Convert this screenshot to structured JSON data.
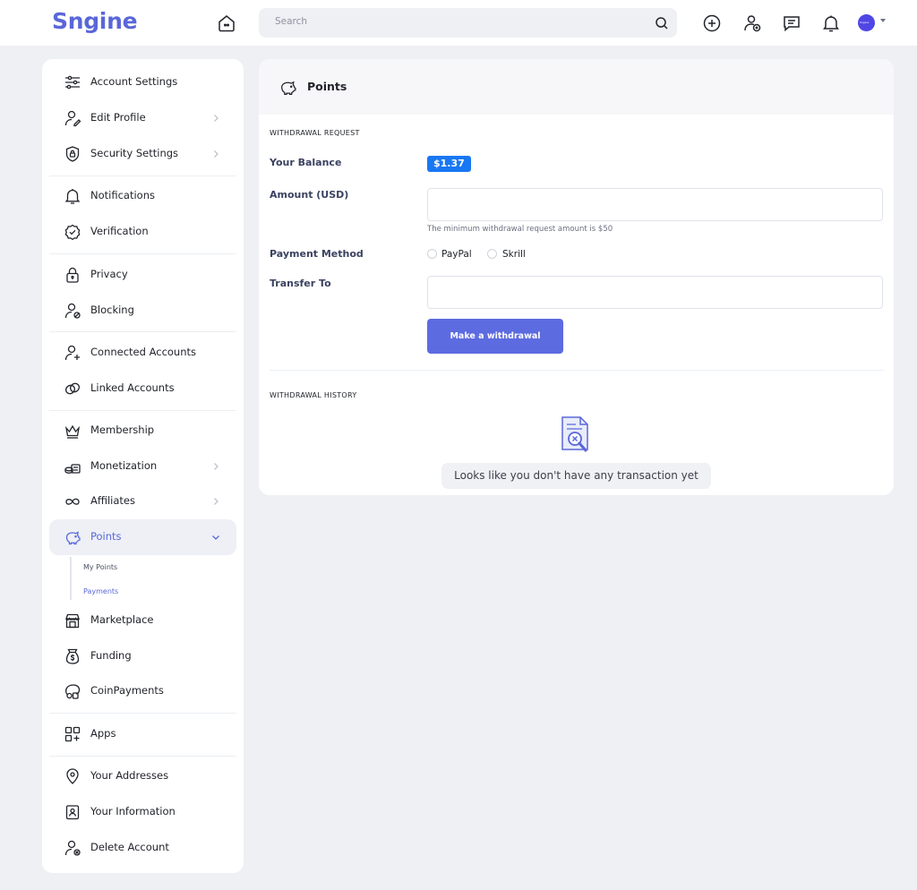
{
  "header": {
    "logo": "Sngine",
    "search_placeholder": "Search",
    "icons": [
      "home-icon",
      "search-icon",
      "add-circle-icon",
      "add-user-icon",
      "messages-icon",
      "notifications-icon",
      "avatar",
      "chevron-down-icon"
    ]
  },
  "sidebar": {
    "items": [
      {
        "label": "Account Settings",
        "icon": "sliders-icon"
      },
      {
        "label": "Edit Profile",
        "icon": "edit-user-icon"
      },
      {
        "label": "Security Settings",
        "icon": "shield-lock-icon"
      },
      {
        "label": "Notifications",
        "icon": "bell-icon"
      },
      {
        "label": "Verification",
        "icon": "verified-icon"
      },
      {
        "label": "Privacy",
        "icon": "lock-icon"
      },
      {
        "label": "Blocking",
        "icon": "block-user-icon"
      },
      {
        "label": "Connected Accounts",
        "icon": "connected-user-icon"
      },
      {
        "label": "Linked Accounts",
        "icon": "link-icon"
      },
      {
        "label": "Membership",
        "icon": "crown-icon"
      },
      {
        "label": "Monetization",
        "icon": "coins-icon"
      },
      {
        "label": "Affiliates",
        "icon": "infinity-icon"
      },
      {
        "label": "Points",
        "icon": "piggy-bank-icon"
      },
      {
        "label": "Marketplace",
        "icon": "store-icon"
      },
      {
        "label": "Funding",
        "icon": "money-bag-icon"
      },
      {
        "label": "CoinPayments",
        "icon": "coin-payments-icon"
      },
      {
        "label": "Apps",
        "icon": "apps-icon"
      },
      {
        "label": "Your Addresses",
        "icon": "location-pin-icon"
      },
      {
        "label": "Your Information",
        "icon": "id-card-icon"
      },
      {
        "label": "Delete Account",
        "icon": "remove-user-icon"
      }
    ],
    "sub_items": [
      {
        "label": "My Points"
      },
      {
        "label": "Payments"
      }
    ]
  },
  "main": {
    "title": "Points",
    "withdrawal_request_title": "WITHDRAWAL REQUEST",
    "balance_label": "Your Balance",
    "balance_value": "$1.37",
    "amount_label": "Amount (USD)",
    "amount_value": "",
    "hint": "The minimum withdrawal request amount is $50",
    "payment_method_label": "Payment Method",
    "payment_methods": [
      "PayPal",
      "Skrill"
    ],
    "transfer_to_label": "Transfer To",
    "transfer_to_value": "",
    "submit_label": "Make a withdrawal",
    "withdrawal_history_title": "WITHDRAWAL HISTORY",
    "empty_message": "Looks like you don't have any transaction yet"
  },
  "colors": {
    "accent": "#5a67d8",
    "badge": "#1877f2",
    "button": "#5d6be0",
    "background": "#eef0f4"
  }
}
